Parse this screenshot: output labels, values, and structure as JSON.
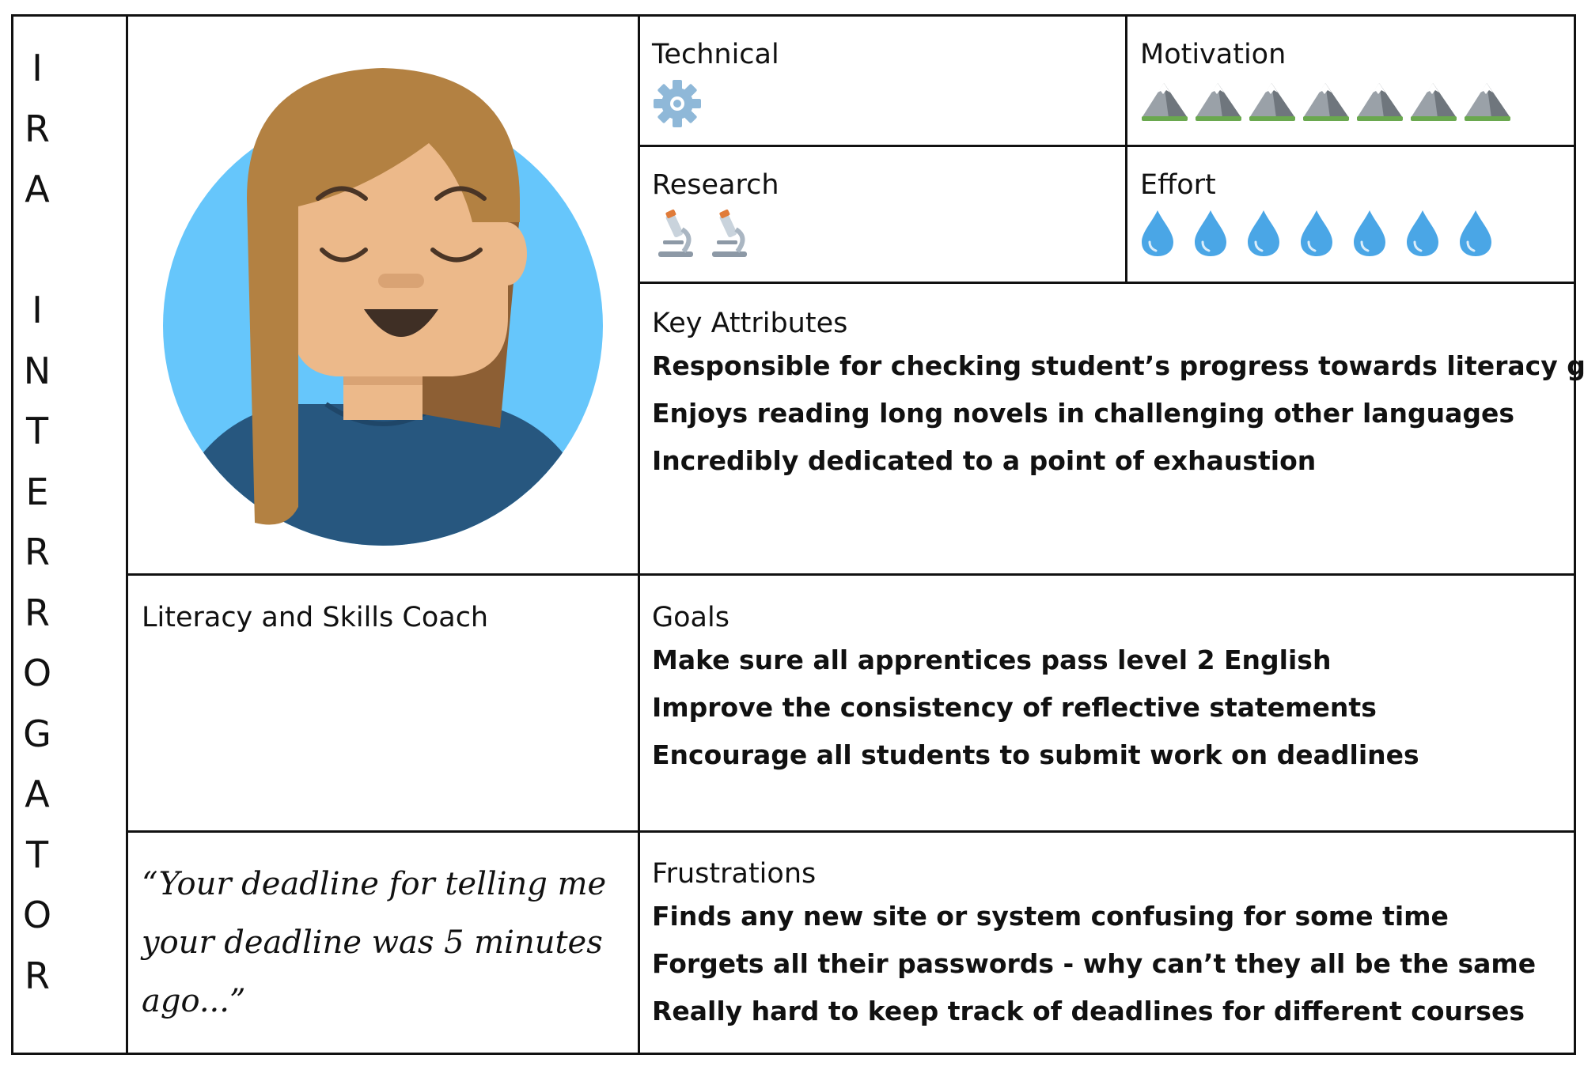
{
  "persona": {
    "name_letters": [
      "I",
      "R",
      "A",
      "",
      "I",
      "N",
      "T",
      "E",
      "R",
      "R",
      "O",
      "G",
      "A",
      "T",
      "O",
      "R"
    ],
    "role": "Literacy and Skills Coach",
    "quote": "“Your deadline for telling me your deadline was 5 minutes ago...”"
  },
  "ratings": {
    "technical": {
      "label": "Technical",
      "count": 1,
      "icon": "gear-icon",
      "color": "#8fb8d8"
    },
    "motivation": {
      "label": "Motivation",
      "count": 7,
      "icon": "mountain-icon"
    },
    "research": {
      "label": "Research",
      "count": 2,
      "icon": "microscope-icon"
    },
    "effort": {
      "label": "Effort",
      "count": 7,
      "icon": "droplet-icon",
      "color": "#4aa6e6"
    }
  },
  "key_attributes": {
    "label": "Key Attributes",
    "items": [
      "Responsible for checking student’s progress towards literacy goals",
      "Enjoys reading long novels in challenging other languages",
      "Incredibly dedicated to a point of exhaustion"
    ]
  },
  "goals": {
    "label": "Goals",
    "items": [
      "Make sure all apprentices pass level 2 English",
      "Improve the consistency of reflective statements",
      "Encourage all students to submit work on deadlines"
    ]
  },
  "frustrations": {
    "label": "Frustrations",
    "items": [
      "Finds any new site or system confusing for some time",
      "Forgets all their passwords - why can’t they all be the same",
      "Really hard to keep track of deadlines for different courses"
    ]
  },
  "colors": {
    "avatar_bg": "#66c6fb",
    "hair": "#b38142",
    "hair_shadow": "#8d5f34",
    "skin": "#ecb98a",
    "shirt": "#27577f",
    "border": "#111111"
  }
}
